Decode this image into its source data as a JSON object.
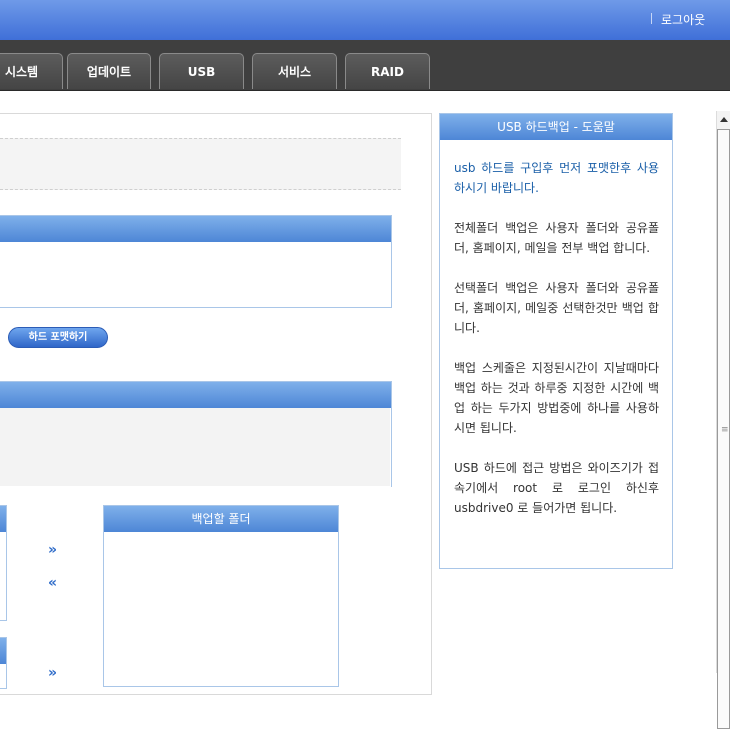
{
  "header": {
    "logout_label": "로그아웃"
  },
  "nav": {
    "tabs": [
      {
        "label": "시스템"
      },
      {
        "label": "업데이트"
      },
      {
        "label": "USB"
      },
      {
        "label": "서비스"
      },
      {
        "label": "RAID"
      }
    ]
  },
  "main": {
    "format_button_label": "하드 포맷하기",
    "backup_folder_title": "백업할 폴더",
    "move_right_icon": "double-chevron-right-icon",
    "move_left_icon": "double-chevron-left-icon"
  },
  "help": {
    "title": "USB 하드백업 - 도움말",
    "paragraphs": [
      "usb 하드를 구입후 먼저 포맷한후 사용하시기 바랍니다.",
      "전체폴더 백업은 사용자 폴더와 공유폴더, 홈페이지, 메일을 전부 백업 합니다.",
      "선택폴더 백업은 사용자 폴더와 공유폴더, 홈페이지, 메일중 선택한것만 백업 합니다.",
      "백업 스케줄은 지정된시간이 지날때마다 백업 하는 것과 하루중 지정한 시간에 백업 하는 두가지 방법중에 하나를 사용하시면 됩니다.",
      "USB 하드에 접근 방법은 와이즈기가 접속기에서 root 로 로그인 하신후 usbdrive0 로 들어가면 됩니다."
    ]
  },
  "colors": {
    "accent": "#4d86d6",
    "topbar": "#3f6fd8",
    "navbar": "#3f3f3f"
  }
}
